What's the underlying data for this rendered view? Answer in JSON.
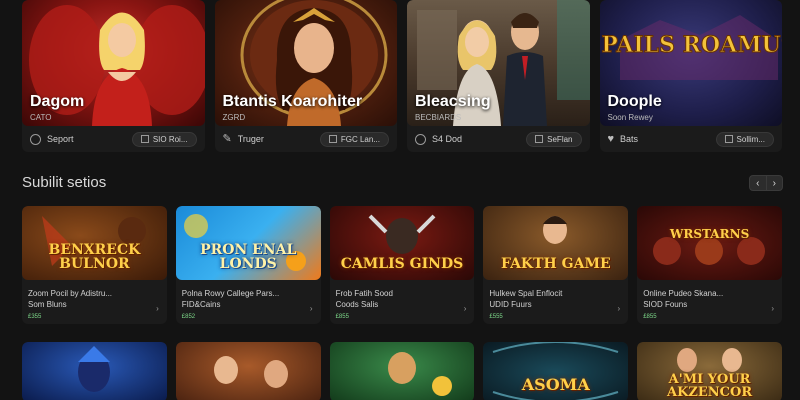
{
  "featured": [
    {
      "title": "Dagom",
      "sub": "CATO",
      "meta_left": "Seport",
      "pill": "SIO Roi...",
      "left_icon": "circle-icon",
      "pill_icon": "box-icon"
    },
    {
      "title": "Btantis Koarohiter",
      "sub": "ZGRD",
      "meta_left": "Truger",
      "pill": "FGC Lan...",
      "left_icon": "feather-icon",
      "pill_icon": "box-icon"
    },
    {
      "title": "Bleacsing",
      "sub": "BECBIARDS",
      "meta_left": "S4 Dod",
      "pill": "SeFlan",
      "left_icon": "circle-icon",
      "pill_icon": "box-icon"
    },
    {
      "title": "Doople",
      "sub": "Soon Rewey",
      "meta_left": "Bats",
      "pill": "Sollim...",
      "left_icon": "heart-icon",
      "pill_icon": "box-icon"
    }
  ],
  "featured_logo": "PAILS ROAMUS",
  "section": {
    "title": "Subilit setios",
    "prev": "‹",
    "next": "›"
  },
  "games_row1": [
    {
      "logo": "BENXRECK BULNOR",
      "line1": "Zoom Pocil by Adistru...",
      "line2": "Som Bluns",
      "tag": "£355"
    },
    {
      "logo": "PRON ENAL LONDS",
      "line1": "Polna Rowy Callege Pars...",
      "line2": "FID&Cains",
      "tag": "£852"
    },
    {
      "logo": "CAMLIS GINDS",
      "line1": "Frob Fatih Sood",
      "line2": "Coods Salis",
      "tag": "£855"
    },
    {
      "logo": "FAKTH GAME",
      "line1": "Hulkew Spal Enflocit",
      "line2": "UDID Fuurs",
      "tag": "£555"
    },
    {
      "logo": "WRSTARNS",
      "line1": "Online Pudeo Skana...",
      "line2": "SIOD Founs",
      "tag": "£855"
    }
  ],
  "games_row2": [
    {
      "logo": ""
    },
    {
      "logo": ""
    },
    {
      "logo": ""
    },
    {
      "logo": "ASOMA"
    },
    {
      "logo": "A'MI YOUR AKZENCOR"
    }
  ],
  "colors": {
    "background": "#131313",
    "card": "#1b1b1b",
    "accent_gold": "#ffd04a",
    "tag_green": "#7ed98a"
  }
}
